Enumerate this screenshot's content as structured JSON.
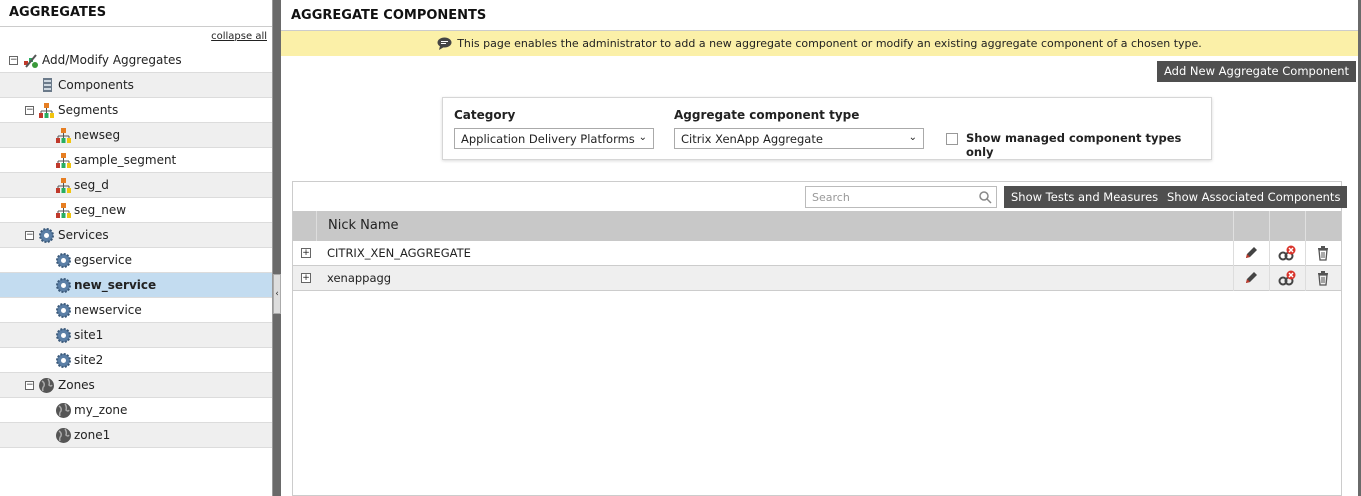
{
  "sidebar": {
    "title": "AGGREGATES",
    "collapse_all": "collapse all",
    "items": [
      {
        "label": "Add/Modify Aggregates",
        "icon": "add-aggregates-icon"
      },
      {
        "label": "Components",
        "icon": "server-icon"
      },
      {
        "label": "Segments",
        "icon": "segment-icon"
      },
      {
        "label": "newseg",
        "icon": "segment-icon"
      },
      {
        "label": "sample_segment",
        "icon": "segment-icon"
      },
      {
        "label": "seg_d",
        "icon": "segment-icon"
      },
      {
        "label": "seg_new",
        "icon": "segment-icon"
      },
      {
        "label": "Services",
        "icon": "service-gear-icon"
      },
      {
        "label": "egservice",
        "icon": "service-gear-icon"
      },
      {
        "label": "new_service",
        "icon": "service-gear-icon"
      },
      {
        "label": "newservice",
        "icon": "service-gear-icon"
      },
      {
        "label": "site1",
        "icon": "service-gear-icon"
      },
      {
        "label": "site2",
        "icon": "service-gear-icon"
      },
      {
        "label": "Zones",
        "icon": "globe-icon"
      },
      {
        "label": "my_zone",
        "icon": "globe-icon"
      },
      {
        "label": "zone1",
        "icon": "globe-icon"
      }
    ]
  },
  "main": {
    "title": "AGGREGATE COMPONENTS",
    "info": "This page enables the administrator to add a new aggregate component or modify an existing aggregate component of a chosen type.",
    "add_button": "Add New Aggregate Component",
    "filters": {
      "category_label": "Category",
      "category_value": "Application Delivery Platforms",
      "type_label": "Aggregate component type",
      "type_value": "Citrix XenApp Aggregate",
      "managed_only_label": "Show managed component types only",
      "managed_only_checked": false
    },
    "grid": {
      "search_placeholder": "Search",
      "show_tests_button": "Show Tests and Measures",
      "show_associated_button": "Show Associated Components",
      "column_nick_name": "Nick Name",
      "rows": [
        {
          "name": "CITRIX_XEN_AGGREGATE"
        },
        {
          "name": "xenappagg"
        }
      ]
    }
  },
  "colors": {
    "dark_button": "#4f4f4f",
    "info_bar": "#fbf0a8",
    "selected_row": "#c3dcf0",
    "grid_header": "#c8c8c8"
  }
}
